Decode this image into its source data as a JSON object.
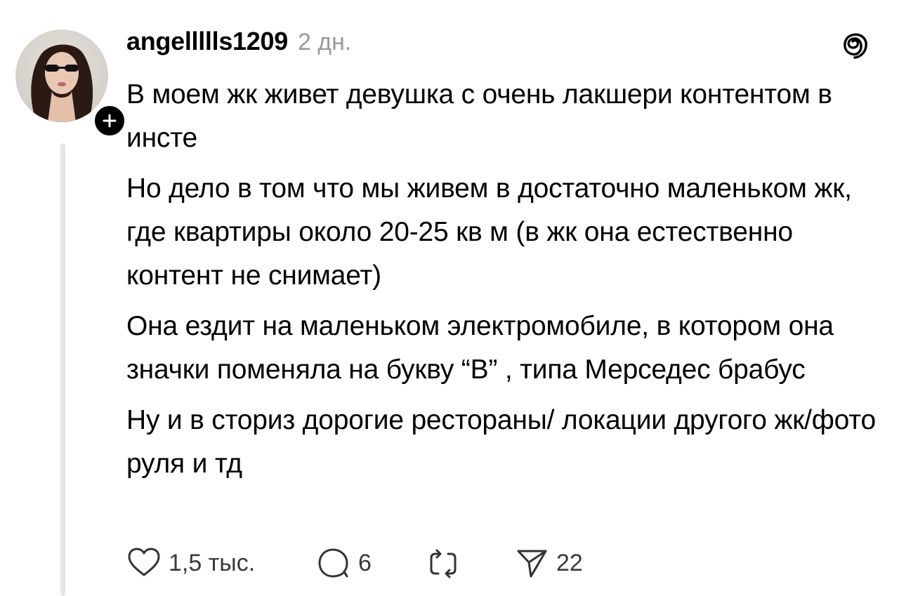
{
  "post": {
    "username": "angellllls1209",
    "timestamp": "2 дн.",
    "paragraphs": [
      "В моем жк живет девушка с очень лакшери контентом в инсте",
      "Но дело в том что мы живем в достаточно маленьком жк, где квартиры около 20-25 кв м (в жк она естественно контент не снимает)",
      "Она ездит на маленьком электромобиле, в котором она значки поменяла на букву “B” , типа Мерседес брабус",
      "Ну и в сториз дорогие рестораны/ локации другого жк/фото руля и тд"
    ]
  },
  "actions": {
    "likes": "1,5 тыс.",
    "replies": "6",
    "shares": "22"
  },
  "icons": {
    "like": "heart-icon",
    "reply": "comment-icon",
    "repost": "repost-icon",
    "share": "send-icon",
    "follow": "plus-icon",
    "app": "threads-logo-icon"
  }
}
